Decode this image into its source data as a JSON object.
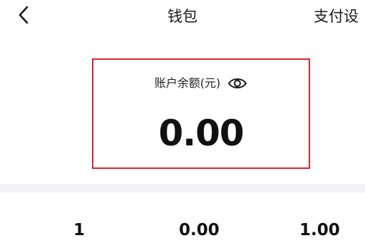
{
  "header": {
    "title": "钱包",
    "settings_label": "支付设"
  },
  "balance": {
    "label": "账户余额(元)",
    "amount": "0.00"
  },
  "stats": [
    "1",
    "0.00",
    "1.00"
  ],
  "colors": {
    "highlight_border": "#e0232b",
    "divider": "#f4f4f6"
  },
  "icons": {
    "back": "chevron-left-icon",
    "visibility": "eye-icon"
  }
}
